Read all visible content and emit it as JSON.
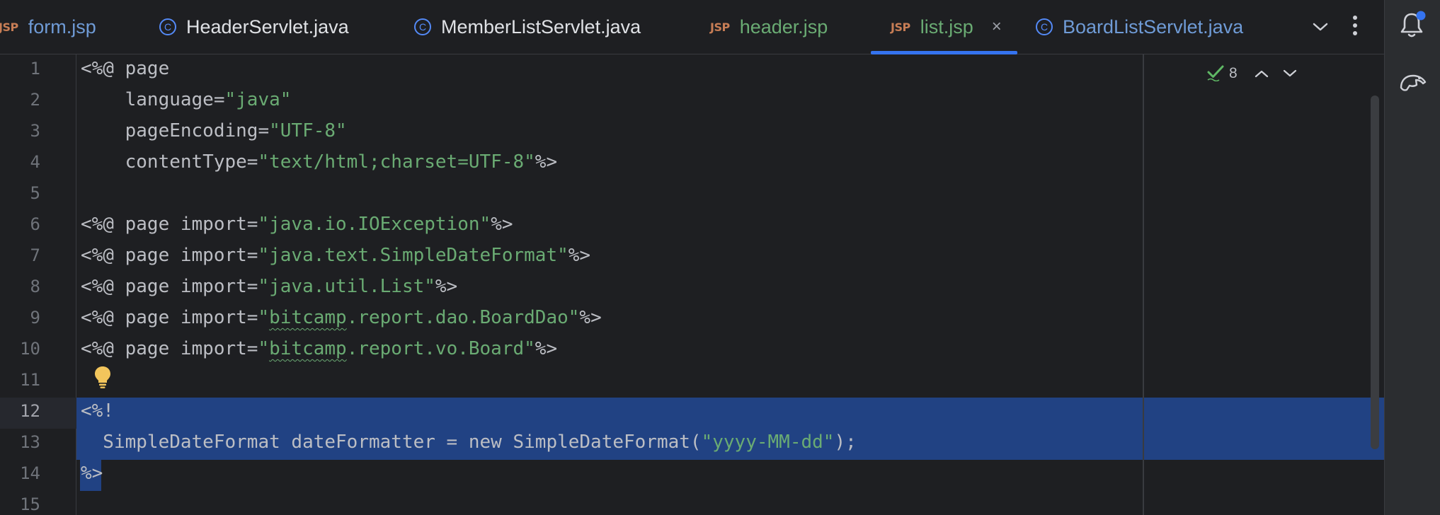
{
  "tabs": [
    {
      "label": "form.jsp",
      "kind": "jsp",
      "icon": "jsp-file-icon",
      "icon_text": "JSP"
    },
    {
      "label": "HeaderServlet.java",
      "kind": "java",
      "icon": "java-class-icon",
      "icon_text": "C"
    },
    {
      "label": "MemberListServlet.java",
      "kind": "java",
      "icon": "java-class-icon",
      "icon_text": "C"
    },
    {
      "label": "header.jsp",
      "kind": "jsp",
      "icon": "jsp-file-icon",
      "icon_text": "JSP"
    },
    {
      "label": "list.jsp",
      "kind": "jsp",
      "icon": "jsp-file-icon",
      "icon_text": "JSP",
      "active": true,
      "close_glyph": "×"
    },
    {
      "label": "BoardListServlet.java",
      "kind": "java",
      "icon": "java-class-icon",
      "icon_text": "C"
    }
  ],
  "editor": {
    "inspection_count": "8",
    "line_numbers": [
      "1",
      "2",
      "3",
      "4",
      "5",
      "6",
      "7",
      "8",
      "9",
      "10",
      "11",
      "12",
      "13",
      "14",
      "15"
    ],
    "current_line": "12",
    "lines": [
      [
        {
          "t": "<%@ page"
        }
      ],
      [
        {
          "t": "    language="
        },
        {
          "t": "\"java\"",
          "c": "str"
        }
      ],
      [
        {
          "t": "    pageEncoding="
        },
        {
          "t": "\"UTF-8\"",
          "c": "str"
        }
      ],
      [
        {
          "t": "    contentType="
        },
        {
          "t": "\"text/html;charset=UTF-8\"",
          "c": "str"
        },
        {
          "t": "%>"
        }
      ],
      [],
      [
        {
          "t": "<%@ page import="
        },
        {
          "t": "\"java.io.IOException\"",
          "c": "str"
        },
        {
          "t": "%>"
        }
      ],
      [
        {
          "t": "<%@ page import="
        },
        {
          "t": "\"java.text.SimpleDateFormat\"",
          "c": "str"
        },
        {
          "t": "%>"
        }
      ],
      [
        {
          "t": "<%@ page import="
        },
        {
          "t": "\"java.util.List\"",
          "c": "str"
        },
        {
          "t": "%>"
        }
      ],
      [
        {
          "t": "<%@ page import="
        },
        {
          "t": "\"",
          "c": "str"
        },
        {
          "t": "bitcamp",
          "c": "str squig"
        },
        {
          "t": ".report.dao.BoardDao\"",
          "c": "str"
        },
        {
          "t": "%>"
        }
      ],
      [
        {
          "t": "<%@ page import="
        },
        {
          "t": "\"",
          "c": "str"
        },
        {
          "t": "bitcamp",
          "c": "str squig"
        },
        {
          "t": ".report.vo.Board\"",
          "c": "str"
        },
        {
          "t": "%>"
        }
      ],
      [],
      [
        {
          "t": "<%!"
        }
      ],
      [
        {
          "t": "  SimpleDateFormat dateFormatter = new SimpleDateFormat("
        },
        {
          "t": "\"yyyy-MM-dd\"",
          "c": "str"
        },
        {
          "t": ");"
        }
      ],
      [
        {
          "t": "%>"
        }
      ],
      []
    ]
  },
  "colors": {
    "background": "#1e1f22",
    "selection": "#214283",
    "string": "#6aab73",
    "text": "#bcbec4",
    "accent": "#3574f0"
  },
  "icons": {
    "tab_menu": "chevron-down-icon",
    "tab_more": "more-vertical-icon",
    "notifications": "notifications-bell-icon",
    "database": "database-icon",
    "intention": "lightbulb-icon",
    "inspections_ok": "check-icon"
  }
}
